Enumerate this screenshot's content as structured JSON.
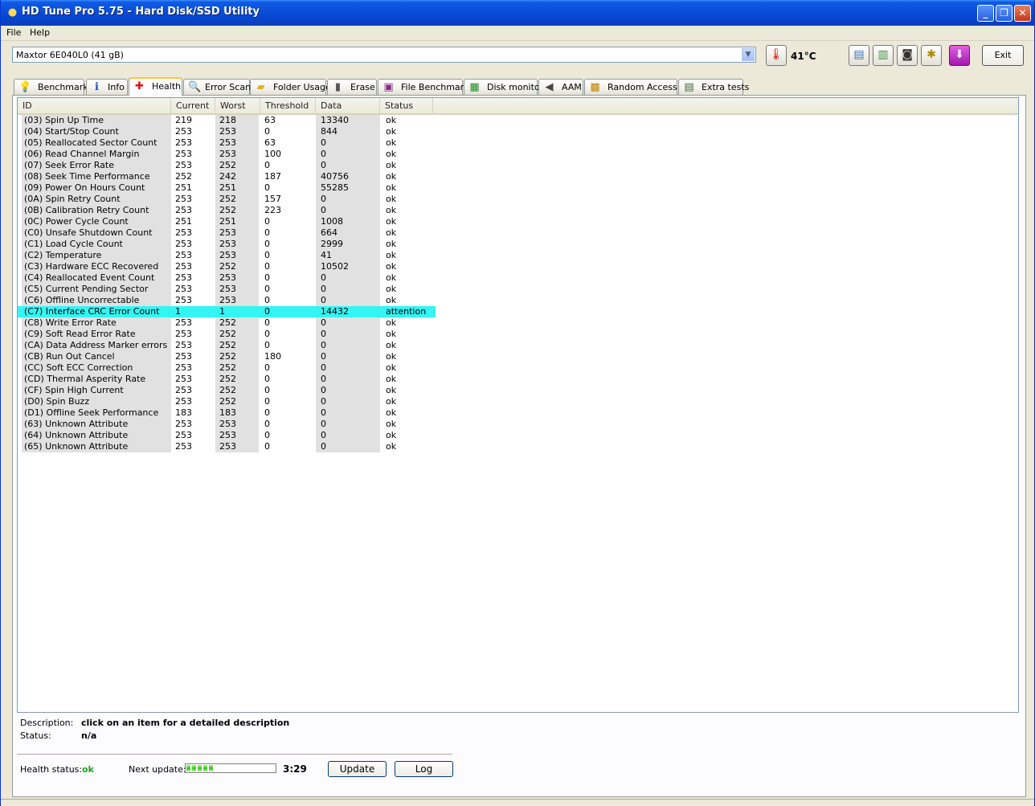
{
  "window": {
    "title": "HD Tune Pro 5.75 - Hard Disk/SSD Utility"
  },
  "menu": {
    "file": "File",
    "help": "Help"
  },
  "toolbar": {
    "drive": "Maxtor 6E040L0 (41 gB)",
    "temperature": "41°C",
    "exit_label": "Exit"
  },
  "tabs": [
    {
      "label": "Benchmark",
      "icon": "lightbulb-icon"
    },
    {
      "label": "Info",
      "icon": "info-icon"
    },
    {
      "label": "Health",
      "icon": "health-cross-icon"
    },
    {
      "label": "Error Scan",
      "icon": "magnifier-icon"
    },
    {
      "label": "Folder Usage",
      "icon": "folder-icon"
    },
    {
      "label": "Erase",
      "icon": "trash-icon"
    },
    {
      "label": "File Benchmark",
      "icon": "file-benchmark-icon"
    },
    {
      "label": "Disk monitor",
      "icon": "monitor-chart-icon"
    },
    {
      "label": "AAM",
      "icon": "speaker-icon"
    },
    {
      "label": "Random Access",
      "icon": "random-access-icon"
    },
    {
      "label": "Extra tests",
      "icon": "extra-tests-icon"
    }
  ],
  "active_tab": "Health",
  "table": {
    "columns": [
      "ID",
      "Current",
      "Worst",
      "Threshold",
      "Data",
      "Status"
    ],
    "rows": [
      [
        "(03) Spin Up Time",
        "219",
        "218",
        "63",
        "13340",
        "ok"
      ],
      [
        "(04) Start/Stop Count",
        "253",
        "253",
        "0",
        "844",
        "ok"
      ],
      [
        "(05) Reallocated Sector Count",
        "253",
        "253",
        "63",
        "0",
        "ok"
      ],
      [
        "(06) Read Channel Margin",
        "253",
        "253",
        "100",
        "0",
        "ok"
      ],
      [
        "(07) Seek Error Rate",
        "253",
        "252",
        "0",
        "0",
        "ok"
      ],
      [
        "(08) Seek Time Performance",
        "252",
        "242",
        "187",
        "40756",
        "ok"
      ],
      [
        "(09) Power On Hours Count",
        "251",
        "251",
        "0",
        "55285",
        "ok"
      ],
      [
        "(0A) Spin Retry Count",
        "253",
        "252",
        "157",
        "0",
        "ok"
      ],
      [
        "(0B) Calibration Retry Count",
        "253",
        "252",
        "223",
        "0",
        "ok"
      ],
      [
        "(0C) Power Cycle Count",
        "251",
        "251",
        "0",
        "1008",
        "ok"
      ],
      [
        "(C0) Unsafe Shutdown Count",
        "253",
        "253",
        "0",
        "664",
        "ok"
      ],
      [
        "(C1) Load Cycle Count",
        "253",
        "253",
        "0",
        "2999",
        "ok"
      ],
      [
        "(C2) Temperature",
        "253",
        "253",
        "0",
        "41",
        "ok"
      ],
      [
        "(C3) Hardware ECC Recovered",
        "253",
        "252",
        "0",
        "10502",
        "ok"
      ],
      [
        "(C4) Reallocated Event Count",
        "253",
        "253",
        "0",
        "0",
        "ok"
      ],
      [
        "(C5) Current Pending Sector",
        "253",
        "253",
        "0",
        "0",
        "ok"
      ],
      [
        "(C6) Offline Uncorrectable",
        "253",
        "253",
        "0",
        "0",
        "ok"
      ],
      [
        "(C7) Interface CRC Error Count",
        "1",
        "1",
        "0",
        "14432",
        "attention"
      ],
      [
        "(C8) Write Error Rate",
        "253",
        "252",
        "0",
        "0",
        "ok"
      ],
      [
        "(C9) Soft Read Error Rate",
        "253",
        "252",
        "0",
        "0",
        "ok"
      ],
      [
        "(CA) Data Address Marker errors",
        "253",
        "252",
        "0",
        "0",
        "ok"
      ],
      [
        "(CB) Run Out Cancel",
        "253",
        "252",
        "180",
        "0",
        "ok"
      ],
      [
        "(CC) Soft ECC Correction",
        "253",
        "252",
        "0",
        "0",
        "ok"
      ],
      [
        "(CD) Thermal Asperity Rate",
        "253",
        "252",
        "0",
        "0",
        "ok"
      ],
      [
        "(CF) Spin High Current",
        "253",
        "252",
        "0",
        "0",
        "ok"
      ],
      [
        "(D0) Spin Buzz",
        "253",
        "252",
        "0",
        "0",
        "ok"
      ],
      [
        "(D1) Offline Seek Performance",
        "183",
        "183",
        "0",
        "0",
        "ok"
      ],
      [
        "(63) Unknown Attribute",
        "253",
        "253",
        "0",
        "0",
        "ok"
      ],
      [
        "(64) Unknown Attribute",
        "253",
        "253",
        "0",
        "0",
        "ok"
      ],
      [
        "(65) Unknown Attribute",
        "253",
        "253",
        "0",
        "0",
        "ok"
      ]
    ],
    "highlight_color": "#33F5F5"
  },
  "details": {
    "description_label": "Description:",
    "description_value": "click on an item for a detailed description",
    "status_label": "Status:",
    "status_value": "n/a"
  },
  "footer": {
    "health_label": "Health status:",
    "health_value": "ok",
    "health_color": "#22A022",
    "next_update_label": "Next update:",
    "next_update_progress": 0.3,
    "next_update_time": "3:29",
    "update_button": "Update",
    "log_button": "Log"
  }
}
